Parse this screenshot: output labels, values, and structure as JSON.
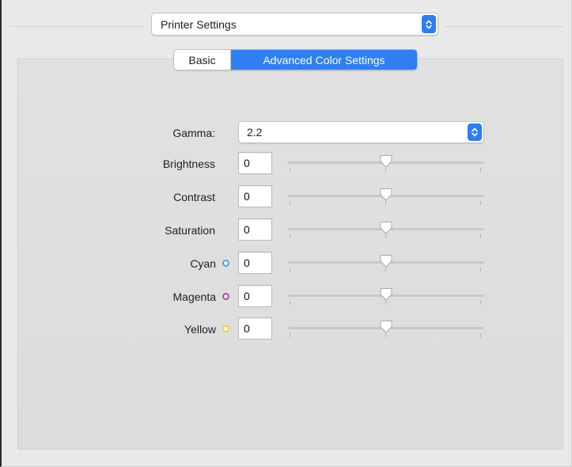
{
  "printer_settings_popup": {
    "value": "Printer Settings"
  },
  "tabs": [
    {
      "label": "Basic",
      "selected": false
    },
    {
      "label": "Advanced Color Settings",
      "selected": true
    }
  ],
  "gamma": {
    "label": "Gamma:",
    "value": "2.2"
  },
  "adjustments": [
    {
      "label": "Brightness",
      "value": "0",
      "slider_fraction": 0.5
    },
    {
      "label": "Contrast",
      "value": "0",
      "slider_fraction": 0.5
    },
    {
      "label": "Saturation",
      "value": "0",
      "slider_fraction": 0.5
    },
    {
      "label": "Cyan",
      "value": "0",
      "slider_fraction": 0.5,
      "dot_color": "#3aa6f0"
    },
    {
      "label": "Magenta",
      "value": "0",
      "slider_fraction": 0.5,
      "dot_color": "#c23db8"
    },
    {
      "label": "Yellow",
      "value": "0",
      "slider_fraction": 0.5,
      "dot_color": "#e8d43a"
    }
  ],
  "colors": {
    "accent": "#2f7ff5",
    "panel": "#dedede"
  },
  "icons": {
    "popup_arrows": "chevron-updown-icon",
    "slider_thumb": "slider-thumb-icon"
  }
}
